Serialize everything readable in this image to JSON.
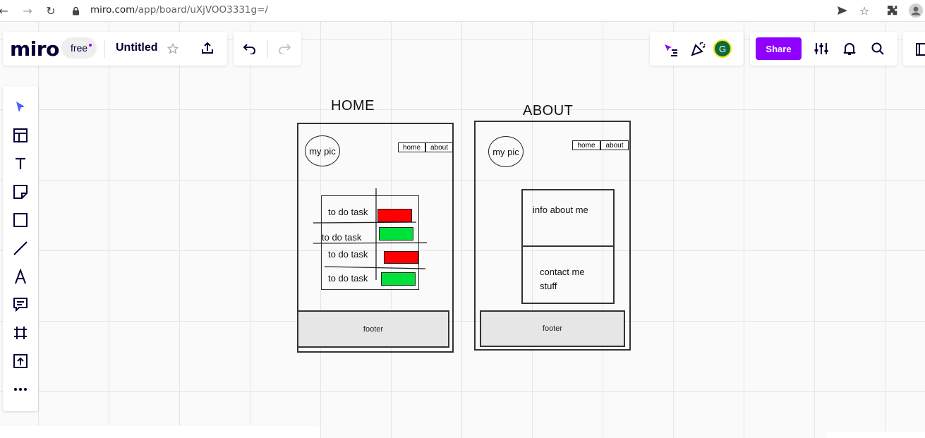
{
  "browser": {
    "url_host": "miro.com",
    "url_path": "/app/board/uXjVOO3331g=/"
  },
  "app": {
    "logo": "miro",
    "plan_badge": "free",
    "board_title": "Untitled",
    "share_label": "Share",
    "avatar_initial": "G",
    "accent_color": "#8f00ff"
  },
  "toolbar": {
    "tools": [
      "select-icon",
      "templates-icon",
      "text-icon",
      "sticky-note-icon",
      "shape-icon",
      "line-icon",
      "pen-icon",
      "comment-icon",
      "frame-icon",
      "upload-icon",
      "more-icon"
    ]
  },
  "wireframes": {
    "home": {
      "title": "HOME",
      "pic_label": "my pic",
      "nav": [
        "home",
        "about"
      ],
      "tasks": [
        "to do task",
        "to do task",
        "to do task",
        "to do task"
      ],
      "task_status_colors": [
        "#ff0000",
        "#00e03a",
        "#ff0000",
        "#00e03a"
      ],
      "footer": "footer"
    },
    "about": {
      "title": "ABOUT",
      "pic_label": "my pic",
      "nav": [
        "home",
        "about"
      ],
      "info_text": "info about me",
      "contact_text": "contact me stuff",
      "footer": "footer"
    }
  }
}
